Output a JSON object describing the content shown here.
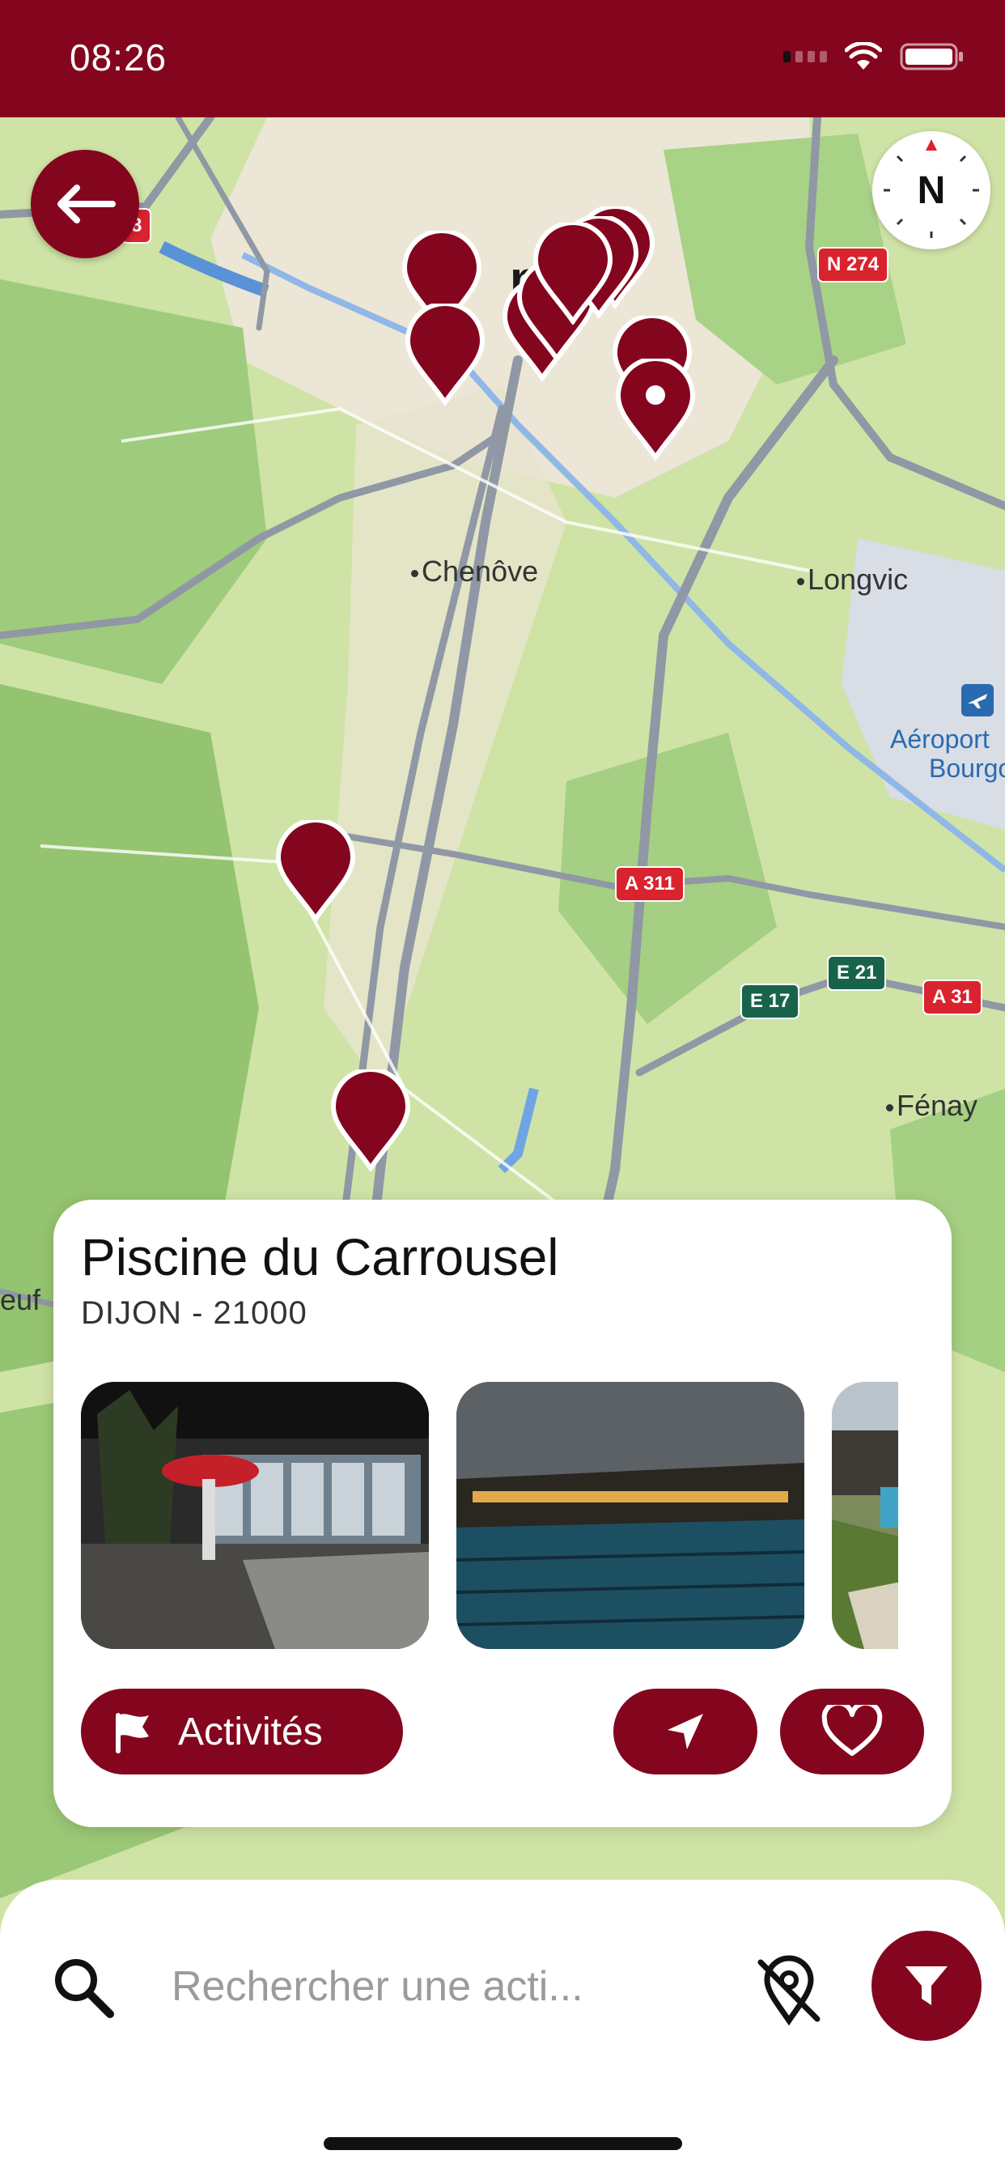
{
  "status_bar": {
    "time": "08:26"
  },
  "map": {
    "labels": {
      "city_partial": "n",
      "chenove": "Chenôve",
      "longvic": "Longvic",
      "airport_line1": "Aéroport",
      "airport_line2": "Bourgo",
      "fenay": "Fénay",
      "left_edge": "euf"
    },
    "shields": {
      "n274": "N 274",
      "a311": "A 311",
      "e21": "E 21",
      "e17": "E 17",
      "a31": "A 31",
      "top_left": "8"
    }
  },
  "compass": {
    "letter": "N"
  },
  "card": {
    "title": "Piscine du Carrousel",
    "subtitle": "DIJON - 21000",
    "activities_label": "Activités"
  },
  "search": {
    "placeholder": "Rechercher une acti..."
  },
  "colors": {
    "brand": "#84061e",
    "map_green": "#cfe3a6",
    "map_road": "#8f98a4"
  }
}
